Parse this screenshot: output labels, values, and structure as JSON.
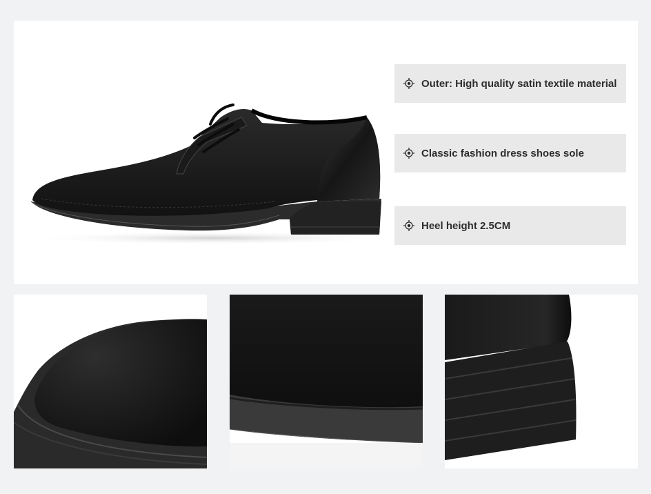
{
  "features": [
    {
      "icon": "target-crosshair-icon",
      "label": "Outer: High quality satin textile material"
    },
    {
      "icon": "target-crosshair-icon",
      "label": "Classic fashion dress shoes sole"
    },
    {
      "icon": "target-crosshair-icon",
      "label": "Heel height 2.5CM"
    }
  ],
  "images": {
    "main": "black-derby-dress-shoe-side-view",
    "detail_1": "toe-cap-closeup",
    "detail_2": "fabric-and-sole-edge-closeup",
    "detail_3": "stacked-heel-closeup"
  },
  "colors": {
    "background": "#f1f2f4",
    "panel": "#ffffff",
    "feature_box": "#e9e9e9",
    "text": "#2d2d2d",
    "shoe": "#1c1c1c"
  }
}
